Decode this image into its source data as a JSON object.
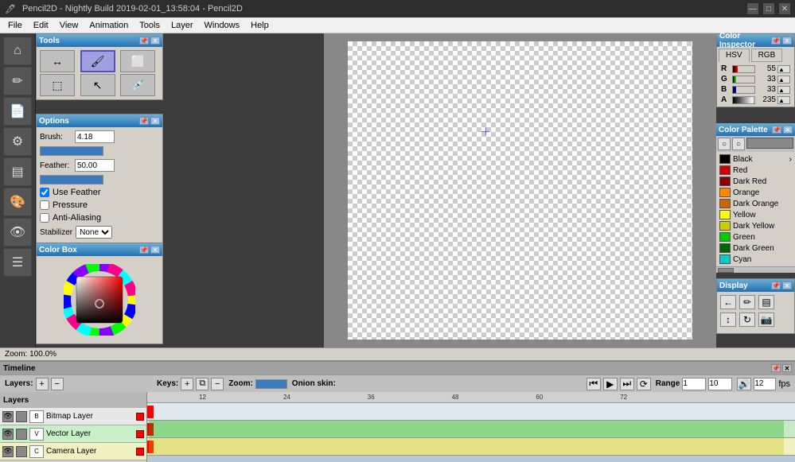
{
  "titlebar": {
    "title": "Pencil2D - Nightly Build 2019-02-01_13:58:04 - Pencil2D",
    "icon": "🖊",
    "minimize": "—",
    "restore": "□",
    "close": "✕"
  },
  "menubar": {
    "items": [
      "File",
      "Edit",
      "View",
      "Animation",
      "Tools",
      "Layer",
      "Windows",
      "Help"
    ]
  },
  "tools_panel": {
    "title": "Tools"
  },
  "options_panel": {
    "title": "Options",
    "brush_label": "Brush:",
    "brush_value": "4.18",
    "feather_label": "Feather:",
    "feather_value": "50.00",
    "use_feather": "Use Feather",
    "pressure": "Pressure",
    "anti_aliasing": "Anti-Aliasing",
    "stabilizer_label": "Stabilizer",
    "stabilizer_value": "None"
  },
  "colorbox_panel": {
    "title": "Color Box"
  },
  "color_inspector": {
    "title": "Color Inspector",
    "tab_hsv": "HSV",
    "tab_rgb": "RGB",
    "r_label": "R",
    "r_value": "55",
    "g_label": "G",
    "g_value": "33",
    "b_label": "B",
    "b_value": "33",
    "a_label": "A",
    "a_value": "235"
  },
  "color_palette": {
    "title": "Color Palette",
    "colors": [
      {
        "name": "Black",
        "hex": "#000000"
      },
      {
        "name": "Red",
        "hex": "#cc0000"
      },
      {
        "name": "Dark Red",
        "hex": "#880000"
      },
      {
        "name": "Orange",
        "hex": "#ff8800"
      },
      {
        "name": "Dark Orange",
        "hex": "#cc6600"
      },
      {
        "name": "Yellow",
        "hex": "#ffff00"
      },
      {
        "name": "Dark Yellow",
        "hex": "#cccc00"
      },
      {
        "name": "Green",
        "hex": "#00cc00"
      },
      {
        "name": "Dark Green",
        "hex": "#006600"
      },
      {
        "name": "Cyan",
        "hex": "#00cccc"
      }
    ]
  },
  "display_panel": {
    "title": "Display"
  },
  "timeline": {
    "title": "Timeline",
    "layers_label": "Layers:",
    "keys_label": "Keys:",
    "zoom_label": "Zoom:",
    "onion_label": "Onion skin:",
    "range_label": "Range",
    "range_start": "1",
    "range_end": "10",
    "fps_value": "12",
    "fps_label": "fps",
    "layers": [
      {
        "name": "Bitmap Layer",
        "type": "bitmap"
      },
      {
        "name": "Vector Layer",
        "type": "vector"
      },
      {
        "name": "Camera Layer",
        "type": "camera"
      }
    ]
  },
  "statusbar": {
    "zoom_label": "Zoom: 100.0%"
  },
  "ruler_ticks": [
    "12",
    "24",
    "36",
    "48",
    "60",
    "72"
  ],
  "display_icons": {
    "arrow_back": "←",
    "pencil": "✏",
    "layers": "▤",
    "move": "↔",
    "rotate": "↻",
    "camera": "📷"
  }
}
